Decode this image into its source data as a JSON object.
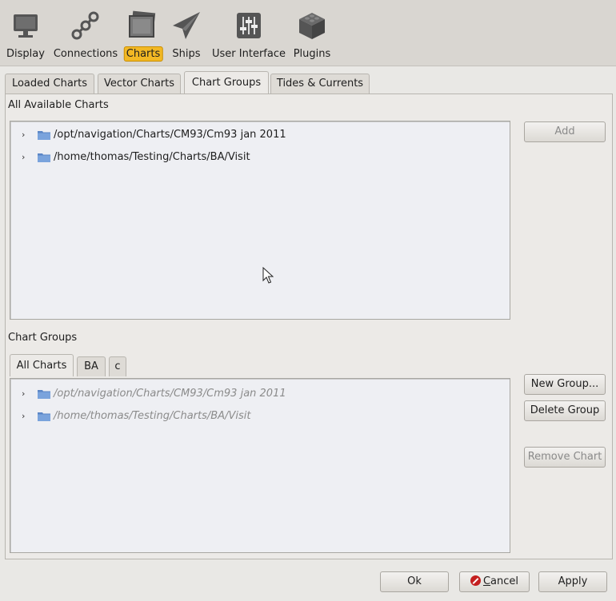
{
  "toolbar": {
    "items": [
      {
        "label": "Display",
        "icon": "monitor-icon"
      },
      {
        "label": "Connections",
        "icon": "connections-icon"
      },
      {
        "label": "Charts",
        "icon": "charts-icon",
        "selected": true
      },
      {
        "label": "Ships",
        "icon": "ships-icon"
      },
      {
        "label": "User Interface",
        "icon": "sliders-icon"
      },
      {
        "label": "Plugins",
        "icon": "plugins-icon"
      }
    ],
    "selected_color": "#f2b824"
  },
  "tabs": [
    {
      "label": "Loaded Charts"
    },
    {
      "label": "Vector Charts"
    },
    {
      "label": "Chart Groups",
      "active": true
    },
    {
      "label": "Tides & Currents"
    }
  ],
  "available": {
    "label": "All Available Charts",
    "items": [
      {
        "path": "/opt/navigation/Charts/CM93/Cm93 jan 2011"
      },
      {
        "path": "/home/thomas/Testing/Charts/BA/Visit"
      }
    ],
    "add_button": "Add"
  },
  "groups": {
    "label": "Chart Groups",
    "tabs": [
      {
        "label": "All Charts",
        "active": true
      },
      {
        "label": "BA"
      },
      {
        "label": "c"
      }
    ],
    "items": [
      {
        "path": "/opt/navigation/Charts/CM93/Cm93 jan 2011"
      },
      {
        "path": "/home/thomas/Testing/Charts/BA/Visit"
      }
    ],
    "new_group_button": "New Group...",
    "delete_group_button": "Delete Group",
    "remove_chart_button": "Remove Chart"
  },
  "footer": {
    "ok": "Ok",
    "cancel_underlined": "C",
    "cancel_rest": "ancel",
    "apply": "Apply"
  }
}
